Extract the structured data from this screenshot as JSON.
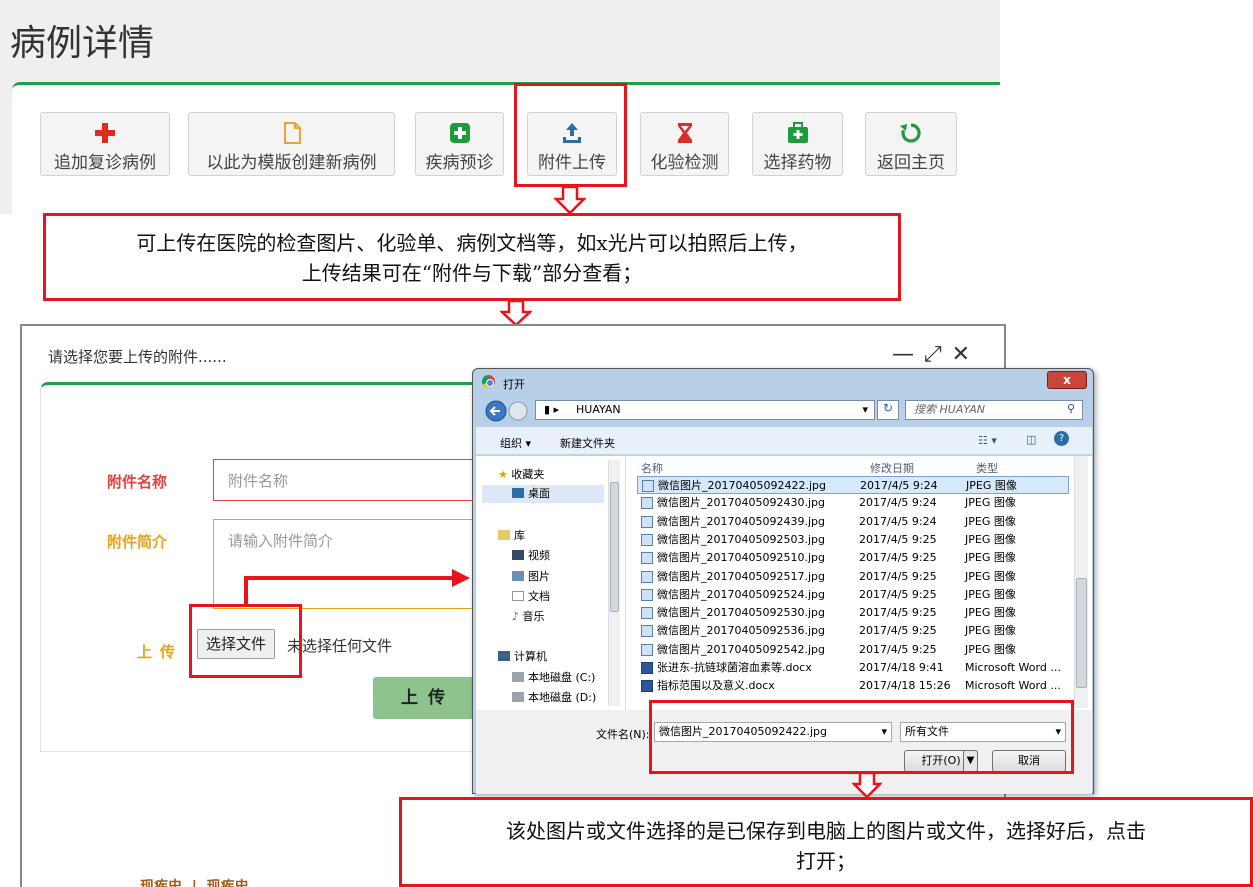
{
  "page": {
    "title": "病例详情",
    "toolbar": [
      {
        "label": "追加复诊病例",
        "icon": "plus-icon"
      },
      {
        "label": "以此为模版创建新病例",
        "icon": "document-icon"
      },
      {
        "label": "疾病预诊",
        "icon": "plus-square-icon"
      },
      {
        "label": "附件上传",
        "icon": "upload-icon"
      },
      {
        "label": "化验检测",
        "icon": "hourglass-icon"
      },
      {
        "label": "选择药物",
        "icon": "medkit-icon"
      },
      {
        "label": "返回主页",
        "icon": "refresh-icon"
      }
    ]
  },
  "annotations": {
    "upload_hint": [
      "可上传在医院的检查图片、化验单、病例文档等，如x光片可以拍照后上传，",
      "上传结果可在“附件与下载”部分查看；"
    ],
    "file_hint": [
      "该处图片或文件选择的是已保存到电脑上的图片或文件，选择好后，点击",
      "打开；"
    ]
  },
  "modal": {
    "title": "请选择您要上传的附件......",
    "name_label": "附件名称",
    "name_placeholder": "附件名称",
    "intro_label": "附件简介",
    "intro_placeholder": "请输入附件简介",
    "upload_label": "上传",
    "choose_file": "选择文件",
    "no_file": "未选择任何文件",
    "submit": "上传",
    "bottom_partial": "现疾史  |  现疾史"
  },
  "dialog": {
    "title": "打开",
    "close": "x",
    "path": "HUAYAN",
    "search_placeholder": "搜索 HUAYAN",
    "organize": "组织 ▾",
    "new_folder": "新建文件夹",
    "nav": [
      {
        "label": "收藏夹",
        "icon": "star-icon"
      },
      {
        "label": "桌面",
        "icon": "desktop-icon"
      },
      {
        "label": "库",
        "icon": "library-icon"
      },
      {
        "label": "视频",
        "icon": "video-icon"
      },
      {
        "label": "图片",
        "icon": "picture-icon"
      },
      {
        "label": "文档",
        "icon": "document-icon"
      },
      {
        "label": "音乐",
        "icon": "music-icon"
      },
      {
        "label": "计算机",
        "icon": "computer-icon"
      },
      {
        "label": "本地磁盘 (C:)",
        "icon": "drive-icon"
      },
      {
        "label": "本地磁盘 (D:)",
        "icon": "drive-icon"
      }
    ],
    "columns": {
      "name": "名称",
      "date": "修改日期",
      "type": "类型"
    },
    "files": [
      {
        "name": "微信图片_20170405092422.jpg",
        "date": "2017/4/5 9:24",
        "type": "JPEG 图像"
      },
      {
        "name": "微信图片_20170405092430.jpg",
        "date": "2017/4/5 9:24",
        "type": "JPEG 图像"
      },
      {
        "name": "微信图片_20170405092439.jpg",
        "date": "2017/4/5 9:24",
        "type": "JPEG 图像"
      },
      {
        "name": "微信图片_20170405092503.jpg",
        "date": "2017/4/5 9:25",
        "type": "JPEG 图像"
      },
      {
        "name": "微信图片_20170405092510.jpg",
        "date": "2017/4/5 9:25",
        "type": "JPEG 图像"
      },
      {
        "name": "微信图片_20170405092517.jpg",
        "date": "2017/4/5 9:25",
        "type": "JPEG 图像"
      },
      {
        "name": "微信图片_20170405092524.jpg",
        "date": "2017/4/5 9:25",
        "type": "JPEG 图像"
      },
      {
        "name": "微信图片_20170405092530.jpg",
        "date": "2017/4/5 9:25",
        "type": "JPEG 图像"
      },
      {
        "name": "微信图片_20170405092536.jpg",
        "date": "2017/4/5 9:25",
        "type": "JPEG 图像"
      },
      {
        "name": "微信图片_20170405092542.jpg",
        "date": "2017/4/5 9:25",
        "type": "JPEG 图像"
      },
      {
        "name": "张进东-抗链球菌溶血素等.docx",
        "date": "2017/4/18 9:41",
        "type": "Microsoft Word ..."
      },
      {
        "name": "指标范围以及意义.docx",
        "date": "2017/4/18 15:26",
        "type": "Microsoft Word ..."
      }
    ],
    "filename_label": "文件名(N):",
    "filename_value": "微信图片_20170405092422.jpg",
    "filter": "所有文件",
    "open": "打开(O)",
    "cancel": "取消"
  },
  "colors": {
    "accent_green": "#1aa34a",
    "annotation_red": "#e8141b"
  }
}
